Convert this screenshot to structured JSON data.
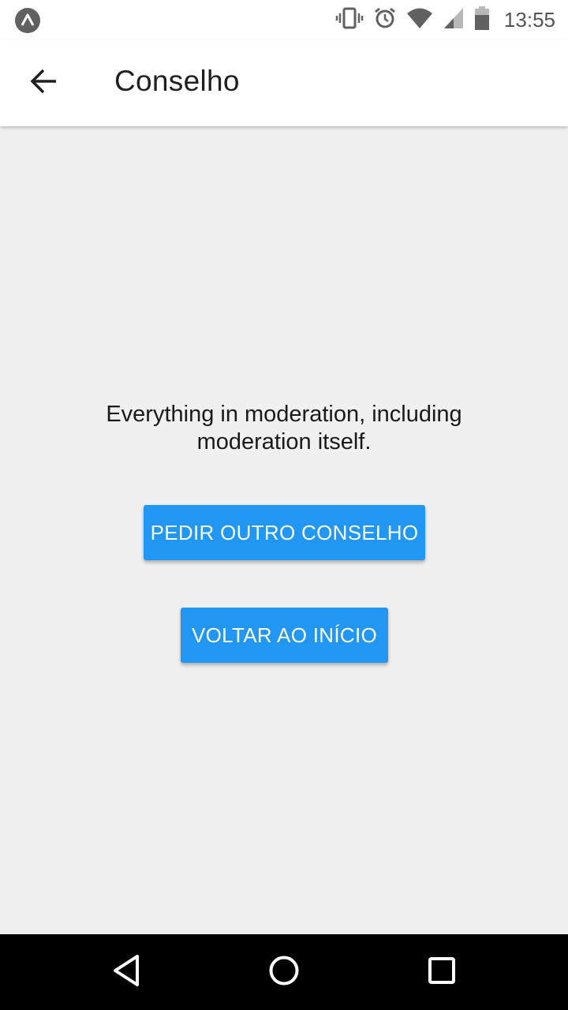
{
  "status_bar": {
    "time": "13:55",
    "icons": [
      "app-notification-icon",
      "vibrate-icon",
      "alarm-icon",
      "wifi-icon",
      "signal-icon",
      "battery-icon"
    ]
  },
  "app_bar": {
    "title": "Conselho",
    "back_icon": "arrow-back-icon"
  },
  "main": {
    "advice": "Everything in moderation, including moderation itself.",
    "another_advice_label": "PEDIR OUTRO CONSELHO",
    "back_home_label": "VOLTAR AO INÍCIO"
  },
  "nav_bar": {
    "icons": [
      "nav-back-icon",
      "nav-home-icon",
      "nav-recents-icon"
    ]
  },
  "colors": {
    "accent": "#2196f3",
    "background": "#f0f0f0",
    "app_bar": "#ffffff",
    "nav_bar": "#000000"
  }
}
